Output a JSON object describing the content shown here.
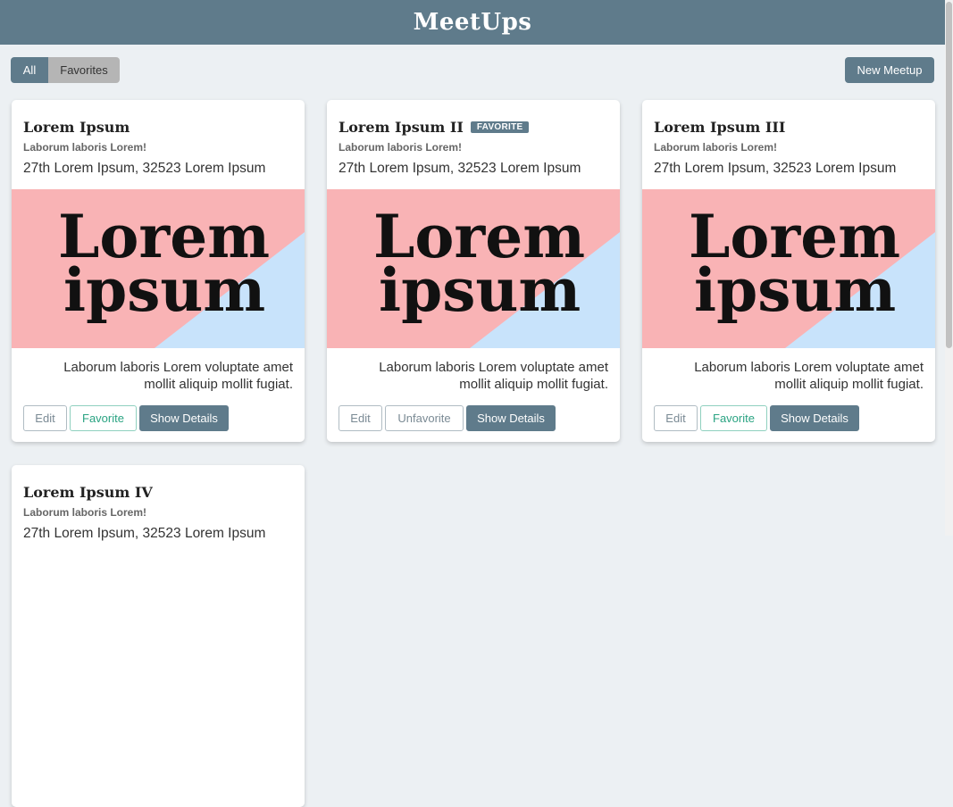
{
  "app": {
    "title": "MeetUps"
  },
  "filter": {
    "all_label": "All",
    "favorites_label": "Favorites"
  },
  "toolbar": {
    "new_label": "New Meetup"
  },
  "image_text": {
    "line1": "Lorem",
    "line2": "ipsum"
  },
  "colors": {
    "header": "#5f7b8b",
    "image_pink": "#f9b3b5",
    "image_blue": "#c8e3fb",
    "favorite_green": "#2aa382"
  },
  "meetups": [
    {
      "title": "Lorem Ipsum",
      "subtitle": "Laborum laboris Lorem!",
      "address": "27th Lorem Ipsum, 32523 Lorem Ipsum",
      "description": "Laborum laboris Lorem voluptate amet mollit aliquip mollit fugiat.",
      "badge": "",
      "edit_label": "Edit",
      "favorite_label": "Favorite",
      "details_label": "Show Details"
    },
    {
      "title": "Lorem Ipsum II",
      "subtitle": "Laborum laboris Lorem!",
      "address": "27th Lorem Ipsum, 32523 Lorem Ipsum",
      "description": "Laborum laboris Lorem voluptate amet mollit aliquip mollit fugiat.",
      "badge": "FAVORITE",
      "edit_label": "Edit",
      "favorite_label": "Unfavorite",
      "details_label": "Show Details"
    },
    {
      "title": "Lorem Ipsum III",
      "subtitle": "Laborum laboris Lorem!",
      "address": "27th Lorem Ipsum, 32523 Lorem Ipsum",
      "description": "Laborum laboris Lorem voluptate amet mollit aliquip mollit fugiat.",
      "badge": "",
      "edit_label": "Edit",
      "favorite_label": "Favorite",
      "details_label": "Show Details"
    },
    {
      "title": "Lorem Ipsum IV",
      "subtitle": "Laborum laboris Lorem!",
      "address": "27th Lorem Ipsum, 32523 Lorem Ipsum"
    }
  ]
}
